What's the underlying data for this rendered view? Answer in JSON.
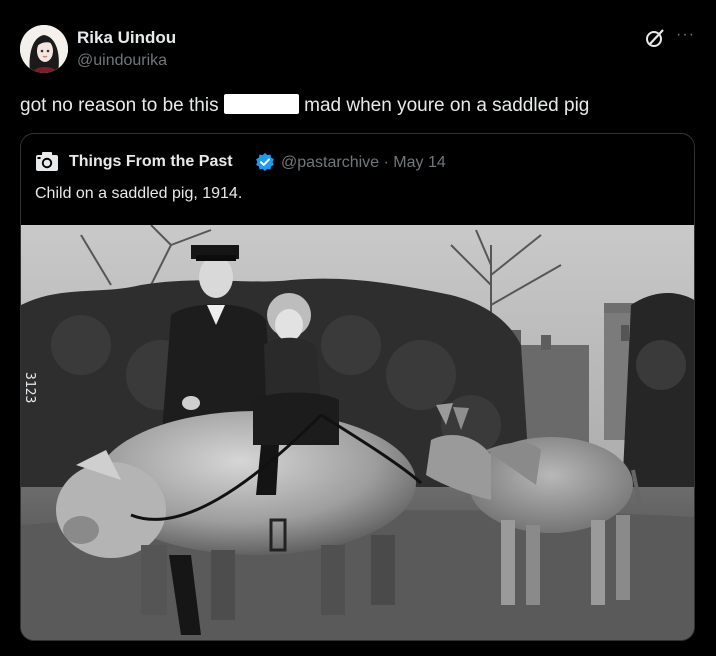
{
  "author": {
    "name": "Rika Uindou",
    "handle": "@uindourika"
  },
  "tweet": {
    "text_before": "got no reason to be this",
    "text_after": "mad when youre on a saddled pig"
  },
  "quoted": {
    "name": "Things From the Past",
    "handle": "@pastarchive",
    "separator": "·",
    "date": "May 14",
    "text": "Child on a saddled pig, 1914.",
    "photo_stamp": "3123"
  },
  "icons": {
    "grok": "grok-icon",
    "more": "more-icon",
    "camera": "camera-icon",
    "verified": "verified-badge-icon",
    "more_glyph": "···"
  },
  "colors": {
    "background": "#000000",
    "text": "#e7e9ea",
    "muted": "#71767b",
    "verified": "#1d9bf0",
    "border": "#2f3336"
  }
}
